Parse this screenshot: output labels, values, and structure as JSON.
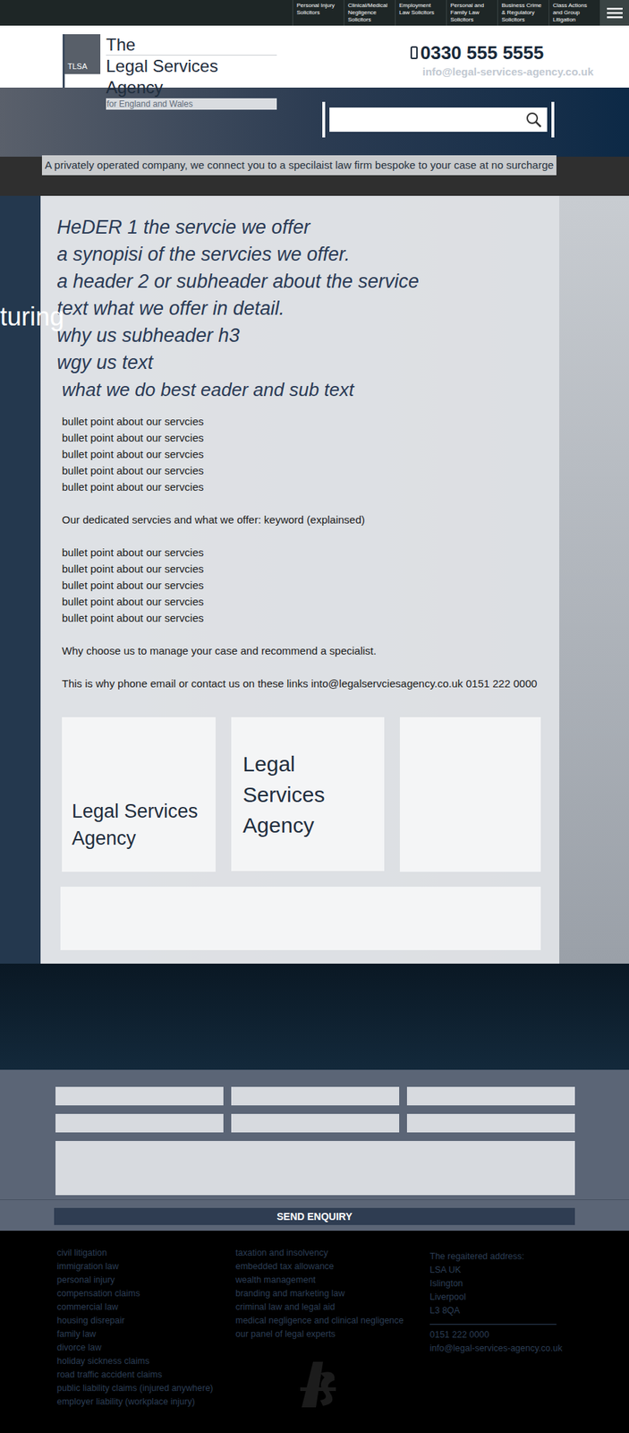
{
  "nav": {
    "items": [
      "Personal Injury Solicitors",
      "Clinical/Medical Negligence Solicitors",
      "Employment Law Solicitors",
      "Personal and Family Law Solicitors",
      "Business Crime & Regulatory Solicitors",
      "Class Actions and Group Litigation"
    ]
  },
  "logo": {
    "badge": "TLSA",
    "line1": "The",
    "line2": "Legal Services Agency",
    "tagline": "for England and Wales"
  },
  "contact": {
    "phone": "0330 555 5555",
    "email": "info@legal-services-agency.co.uk"
  },
  "hero": {
    "tagline": "A privately operated company, we connect you to a specilaist law firm bespoke to your case at no surcharge"
  },
  "watermark": "turing",
  "content": {
    "headings": [
      "HeDER 1 the servcie we offer",
      "a synopisi of the servcies we offer.",
      "a header 2 or subheader about the service",
      "text what we offer in detail.",
      "why us subheader h3",
      "wgy us text"
    ],
    "subheading": "what we do best eader and sub text",
    "bullets1": [
      "bullet point about our servcies",
      "bullet point about our servcies",
      "bullet point about our servcies",
      "bullet point about our servcies",
      "bullet point about our servcies"
    ],
    "keyword_line": "Our dedicated servcies and what we offer: keyword (explainsed)",
    "bullets2": [
      "bullet point about our servcies",
      "bullet point about our servcies",
      "bullet point about our servcies",
      "bullet point about our servcies",
      "bullet point about our servcies"
    ],
    "why_line": "Why choose us to manage your case and recommend a specialist.",
    "contact_line": "This is why phone email or contact us on these links into@legalservciesagency.co.uk 0151 222 0000"
  },
  "cards": [
    "Legal Services Agency",
    "Legal Services Agency"
  ],
  "form": {
    "button": "SEND ENQUIRY"
  },
  "footer": {
    "col1": [
      "civil litigation",
      "immigration law",
      "personal injury",
      "compensation claims",
      "commercial law",
      "housing disrepair",
      "family law",
      "divorce law",
      "holiday sickness claims",
      "road traffic accident claims",
      "public liability claims (injured anywhere)",
      "employer liability (workplace injury)"
    ],
    "col2": [
      "taxation and insolvency",
      "embedded tax allowance",
      "wealth management",
      "branding and marketing law",
      "criminal law and legal aid",
      "medical negligence and clinical negligence",
      "our panel of legal experts"
    ],
    "address": {
      "label": "The regaitered address:",
      "lines": [
        "LSA UK",
        "Islington",
        "Liverpool",
        "L3 8QA"
      ],
      "phone": "0151 222 0000",
      "email": "info@legal-services-agency.co.uk"
    }
  }
}
